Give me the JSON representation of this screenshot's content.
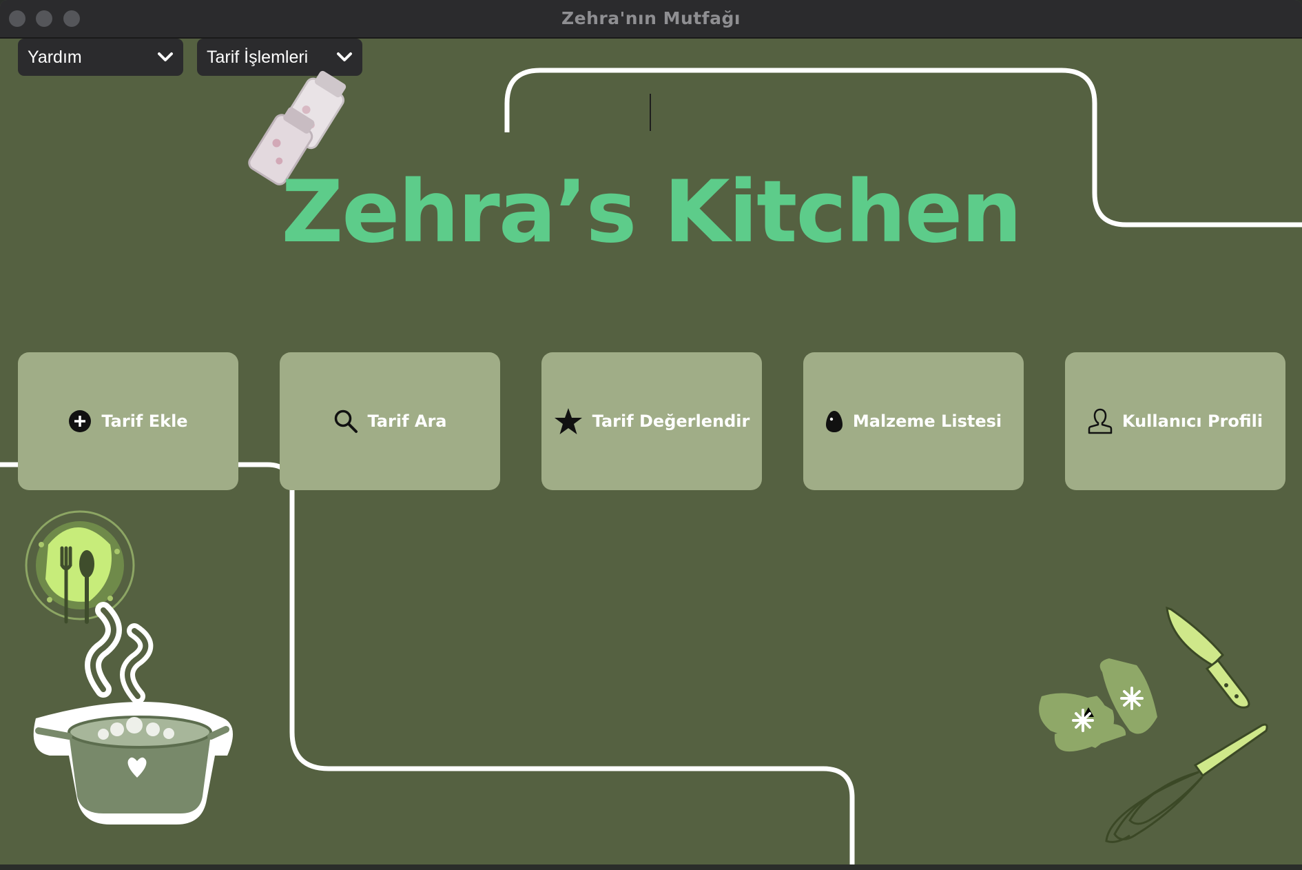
{
  "window": {
    "title": "Zehra'nın Mutfağı"
  },
  "menubar": {
    "menus": [
      {
        "label": "Yardım"
      },
      {
        "label": "Tarif İşlemleri"
      }
    ]
  },
  "header": {
    "brand": "Zehra’s Kitchen"
  },
  "actions": [
    {
      "label": "Tarif Ekle",
      "icon": "add-circle-icon"
    },
    {
      "label": "Tarif Ara",
      "icon": "search-icon"
    },
    {
      "label": "Tarif Değerlendir",
      "icon": "star-icon"
    },
    {
      "label": "Malzeme Listesi",
      "icon": "egg-icon"
    },
    {
      "label": "Kullanıcı Profili",
      "icon": "user-icon"
    }
  ],
  "colors": {
    "background": "#556141",
    "card": "#a0ad87",
    "brand": "#5dcc8a",
    "titlebar": "#2b2b2d"
  }
}
